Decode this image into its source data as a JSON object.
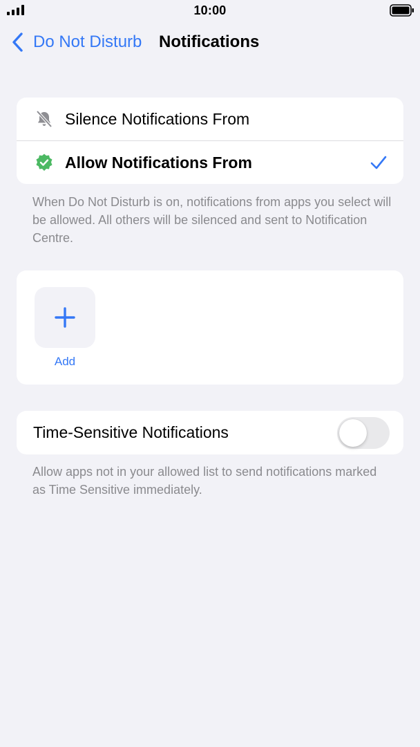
{
  "status_bar": {
    "time": "10:00"
  },
  "nav": {
    "back_label": "Do Not Disturb",
    "title": "Notifications"
  },
  "mode_options": [
    {
      "label": "Silence Notifications From",
      "icon": "bell-slash-icon",
      "selected": false
    },
    {
      "label": "Allow Notifications From",
      "icon": "checkmark-seal-icon",
      "selected": true
    }
  ],
  "mode_footnote": "When Do Not Disturb is on, notifications from apps you select will be allowed. All others will be silenced and sent to Notification Centre.",
  "allowed_apps": {
    "add_label": "Add"
  },
  "time_sensitive": {
    "label": "Time-Sensitive Notifications",
    "enabled": false,
    "footnote": "Allow apps not in your allowed list to send notifications marked as Time Sensitive immediately."
  },
  "colors": {
    "accent": "#3478f6",
    "background": "#f2f2f7",
    "secondary_text": "#8a8a8e",
    "allow_icon_green": "#4cb963",
    "muted_icon": "#8e8e93"
  }
}
